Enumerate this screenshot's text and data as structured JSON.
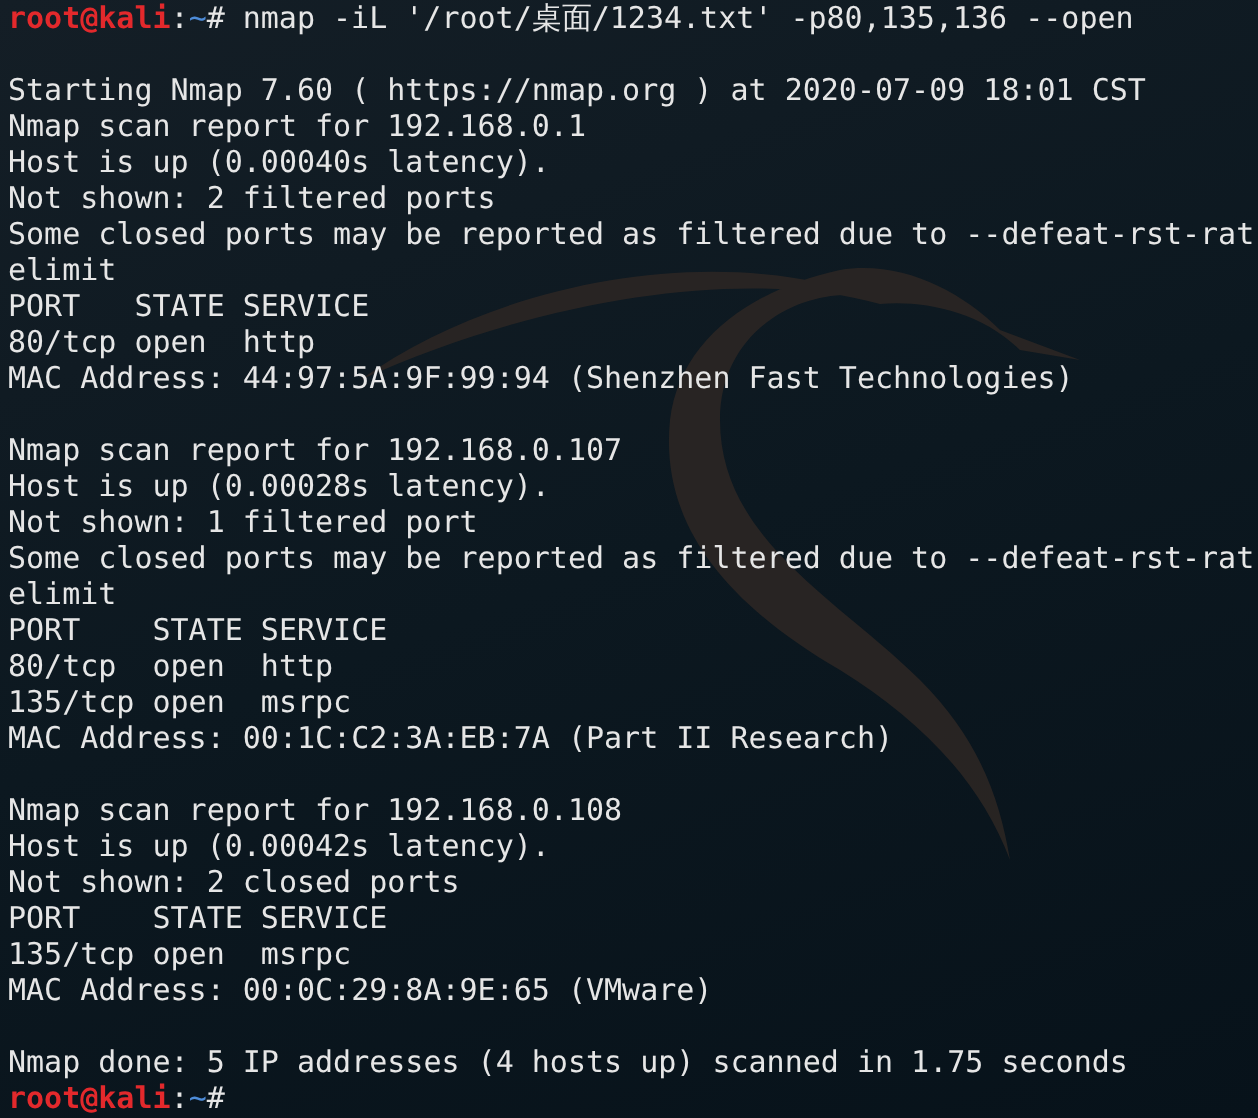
{
  "terminal": {
    "lines": [
      {
        "kind": "prompt",
        "user": "root@kali",
        "separator": ":",
        "path": "~",
        "symbol": "#",
        "command": "nmap -iL '/root/桌面/1234.txt' -p80,135,136 --open"
      },
      {
        "kind": "blank"
      },
      {
        "kind": "output",
        "text": "Starting Nmap 7.60 ( https://nmap.org ) at 2020-07-09 18:01 CST"
      },
      {
        "kind": "output",
        "text": "Nmap scan report for 192.168.0.1"
      },
      {
        "kind": "output",
        "text": "Host is up (0.00040s latency)."
      },
      {
        "kind": "output",
        "text": "Not shown: 2 filtered ports"
      },
      {
        "kind": "output",
        "text": "Some closed ports may be reported as filtered due to --defeat-rst-rat"
      },
      {
        "kind": "output",
        "text": "elimit"
      },
      {
        "kind": "output",
        "text": "PORT   STATE SERVICE"
      },
      {
        "kind": "output",
        "text": "80/tcp open  http"
      },
      {
        "kind": "output",
        "text": "MAC Address: 44:97:5A:9F:99:94 (Shenzhen Fast Technologies)"
      },
      {
        "kind": "blank"
      },
      {
        "kind": "output",
        "text": "Nmap scan report for 192.168.0.107"
      },
      {
        "kind": "output",
        "text": "Host is up (0.00028s latency)."
      },
      {
        "kind": "output",
        "text": "Not shown: 1 filtered port"
      },
      {
        "kind": "output",
        "text": "Some closed ports may be reported as filtered due to --defeat-rst-rat"
      },
      {
        "kind": "output",
        "text": "elimit"
      },
      {
        "kind": "output",
        "text": "PORT    STATE SERVICE"
      },
      {
        "kind": "output",
        "text": "80/tcp  open  http"
      },
      {
        "kind": "output",
        "text": "135/tcp open  msrpc"
      },
      {
        "kind": "output",
        "text": "MAC Address: 00:1C:C2:3A:EB:7A (Part II Research)"
      },
      {
        "kind": "blank"
      },
      {
        "kind": "output",
        "text": "Nmap scan report for 192.168.0.108"
      },
      {
        "kind": "output",
        "text": "Host is up (0.00042s latency)."
      },
      {
        "kind": "output",
        "text": "Not shown: 2 closed ports"
      },
      {
        "kind": "output",
        "text": "PORT    STATE SERVICE"
      },
      {
        "kind": "output",
        "text": "135/tcp open  msrpc"
      },
      {
        "kind": "output",
        "text": "MAC Address: 00:0C:29:8A:9E:65 (VMware)"
      },
      {
        "kind": "blank"
      },
      {
        "kind": "output",
        "text": "Nmap done: 5 IP addresses (4 hosts up) scanned in 1.75 seconds"
      },
      {
        "kind": "prompt",
        "user": "root@kali",
        "separator": ":",
        "path": "~",
        "symbol": "#"
      }
    ]
  }
}
